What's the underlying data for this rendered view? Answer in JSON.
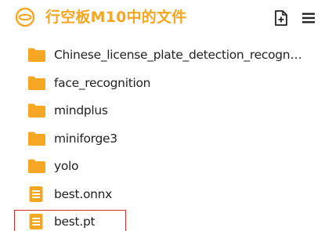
{
  "header": {
    "logo_icon": "ring-logo-icon",
    "title": "行空板M10中的文件",
    "title_color": "#f5a623",
    "new_file_icon": "new-file-icon",
    "menu_icon": "hamburger-menu-icon"
  },
  "files": [
    {
      "name": "Chinese_license_plate_detection_recogniti...",
      "type": "folder",
      "icon": "folder-icon"
    },
    {
      "name": "face_recognition",
      "type": "folder",
      "icon": "folder-icon"
    },
    {
      "name": "mindplus",
      "type": "folder",
      "icon": "folder-icon"
    },
    {
      "name": "miniforge3",
      "type": "folder",
      "icon": "folder-icon"
    },
    {
      "name": "yolo",
      "type": "folder",
      "icon": "folder-icon"
    },
    {
      "name": "best.onnx",
      "type": "file",
      "icon": "document-icon"
    },
    {
      "name": "best.pt",
      "type": "file",
      "icon": "document-icon",
      "highlighted": true
    }
  ],
  "colors": {
    "accent": "#f5a623",
    "highlight_border": "#d32f2f",
    "text": "#222222"
  }
}
